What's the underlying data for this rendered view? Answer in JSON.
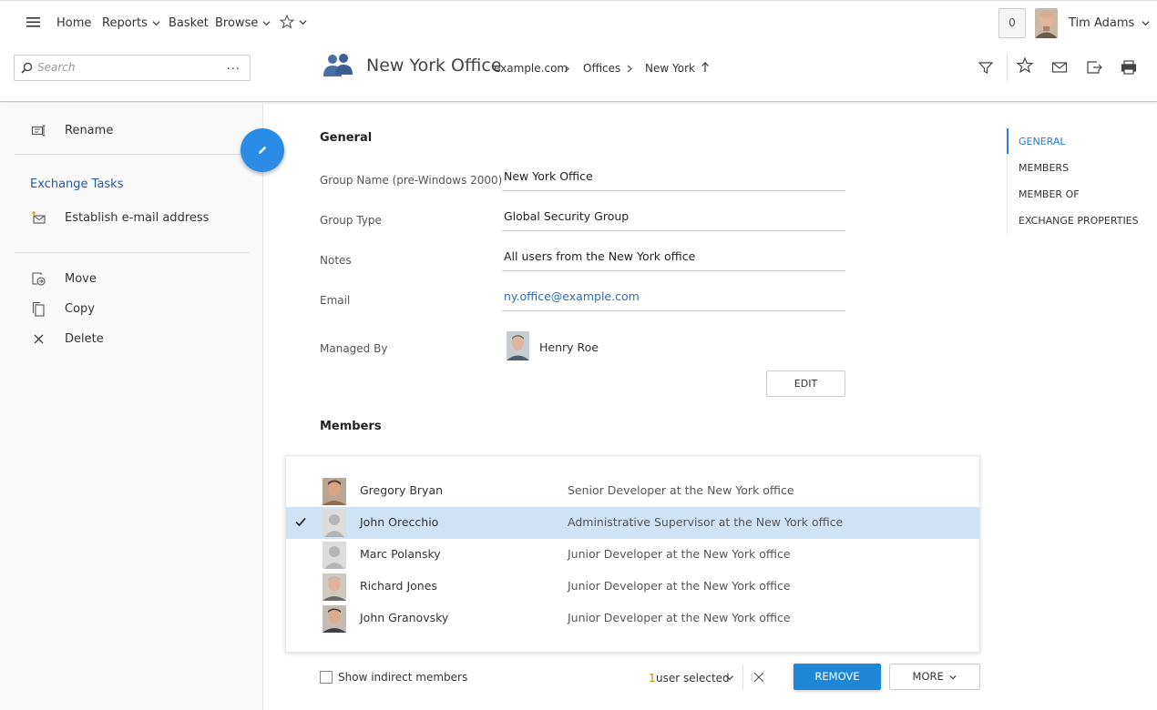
{
  "nav": {
    "home": "Home",
    "reports": "Reports",
    "basket": "Basket",
    "browse": "Browse",
    "notification_count": "0",
    "user_name": "Tim Adams"
  },
  "search": {
    "placeholder": "Search",
    "more": "..."
  },
  "object": {
    "title": "New York Office",
    "breadcrumb": [
      "example.com",
      "Offices",
      "New York"
    ]
  },
  "left_panel": {
    "rename": "Rename",
    "exchange_tasks_heading": "Exchange Tasks",
    "establish_email": "Establish e-mail address",
    "move": "Move",
    "copy": "Copy",
    "delete": "Delete"
  },
  "general": {
    "heading": "General",
    "fields": [
      {
        "label": "Group Name (pre-Windows 2000)",
        "value": "New York Office"
      },
      {
        "label": "Group Type",
        "value": "Global Security Group"
      },
      {
        "label": "Notes",
        "value": "All users from the New York office"
      },
      {
        "label": "Email",
        "value": "ny.office@example.com"
      }
    ],
    "managed_by_label": "Managed By",
    "managed_by_value": "Henry Roe",
    "edit_button": "EDIT"
  },
  "members": {
    "heading": "Members",
    "rows": [
      {
        "name": "Gregory Bryan",
        "title": "Senior Developer at the New York office",
        "selected": false
      },
      {
        "name": "John Orecchio",
        "title": "Administrative Supervisor at the New York office",
        "selected": true
      },
      {
        "name": "Marc Polansky",
        "title": "Junior Developer at the New York office",
        "selected": false
      },
      {
        "name": "Richard Jones",
        "title": "Junior Developer at the New York office",
        "selected": false
      },
      {
        "name": "John Granovsky",
        "title": "Junior Developer at the New York office",
        "selected": false
      }
    ],
    "show_indirect": "Show indirect members",
    "selected_count": "1",
    "selected_suffix": "user selected",
    "remove_button": "REMOVE",
    "more_button": "MORE"
  },
  "right_nav": {
    "items": [
      "GENERAL",
      "MEMBERS",
      "MEMBER OF",
      "EXCHANGE PROPERTIES"
    ],
    "active": "GENERAL"
  },
  "colors": {
    "accent": "#1d86d6",
    "selected_row": "#cfe3f7",
    "link": "#2a6cb8"
  }
}
